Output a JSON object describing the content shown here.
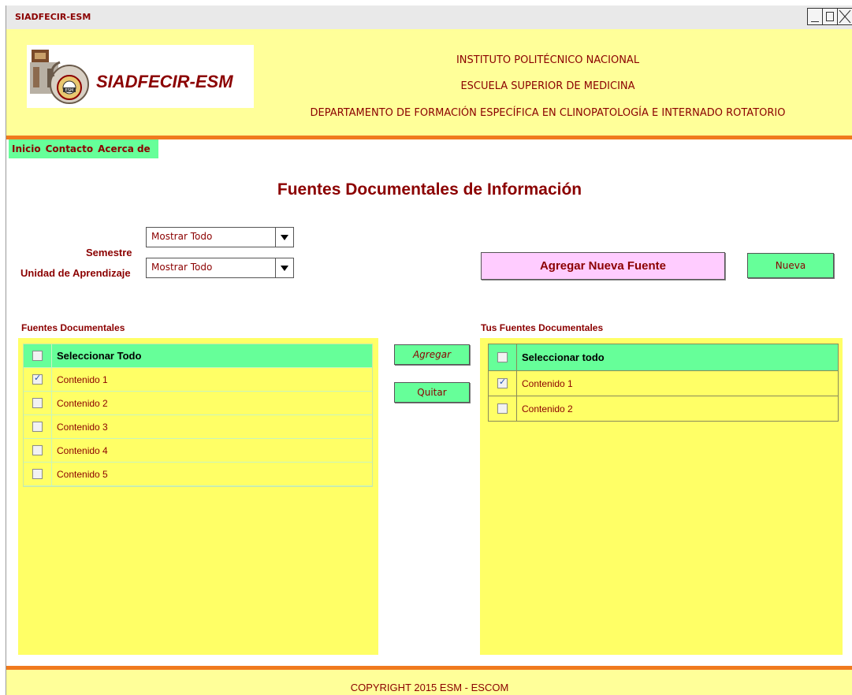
{
  "window": {
    "title": "SIADFECIR-ESM"
  },
  "header": {
    "logo_text": "SIADFECIR-ESM",
    "line1": "INSTITUTO POLITÉCNICO NACIONAL",
    "line2": "ESCUELA SUPERIOR DE MEDICINA",
    "line3": "DEPARTAMENTO DE FORMACIÓN ESPECÍFICA EN CLINOPATOLOGÍA E INTERNADO ROTATORIO"
  },
  "nav": {
    "items": [
      "Inicio",
      "Contacto",
      "Acerca de"
    ]
  },
  "page": {
    "title": "Fuentes Documentales de Información"
  },
  "filters": {
    "semestre_label": "Semestre",
    "semestre_value": "Mostrar Todo",
    "unidad_label": "Unidad de Aprendizaje",
    "unidad_value": "Mostrar Todo"
  },
  "actions": {
    "agregar_nueva_fuente": "Agregar Nueva Fuente",
    "nueva": "Nueva",
    "agregar": "Agregar",
    "quitar": "Quitar"
  },
  "left": {
    "heading": "Fuentes Documentales",
    "select_all": "Seleccionar Todo",
    "rows": [
      {
        "label": "Contenido 1",
        "checked": true
      },
      {
        "label": "Contenido 2",
        "checked": false
      },
      {
        "label": "Contenido 3",
        "checked": false
      },
      {
        "label": "Contenido 4",
        "checked": false
      },
      {
        "label": "Contenido 5",
        "checked": false
      }
    ]
  },
  "right": {
    "heading": "Tus Fuentes Documentales",
    "select_all": "Seleccionar todo",
    "rows": [
      {
        "label": "Contenido 1",
        "checked": true
      },
      {
        "label": "Contenido 2",
        "checked": false
      }
    ]
  },
  "footer": {
    "copyright": "COPYRIGHT 2015 ESM - ESCOM"
  },
  "colors": {
    "header_bg": "#ffff99",
    "panel_bg": "#ffff66",
    "accent_green": "#66ff99",
    "accent_orange": "#f07a1e",
    "text_dark_red": "#8b0000",
    "pink_button": "#ffccff"
  }
}
